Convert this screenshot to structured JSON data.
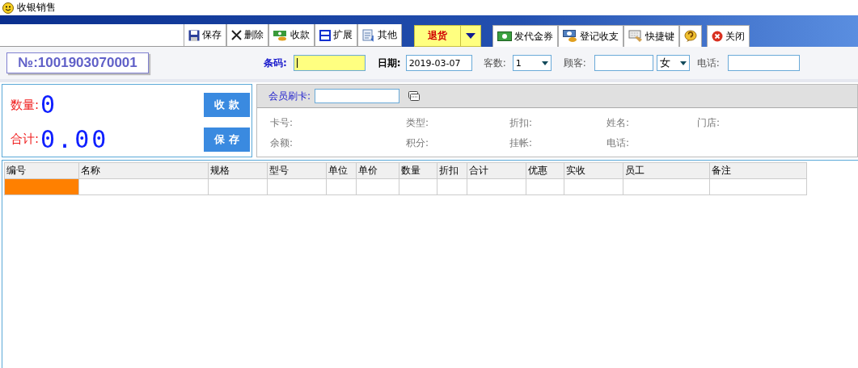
{
  "window": {
    "title": "收银销售"
  },
  "toolbar": {
    "left_buttons": [
      {
        "label": "保存",
        "kind": "save"
      },
      {
        "label": "删除",
        "kind": "delete"
      },
      {
        "label": "收款",
        "kind": "money"
      },
      {
        "label": "扩展",
        "kind": "expand"
      },
      {
        "label": "其他",
        "kind": "other"
      }
    ],
    "return_button": {
      "label": "退货"
    },
    "right_buttons": [
      {
        "label": "发代金券",
        "kind": "voucher"
      },
      {
        "label": "登记收支",
        "kind": "ledger"
      },
      {
        "label": "快捷键",
        "kind": "keyboard"
      },
      {
        "kind": "help"
      }
    ],
    "close_button": {
      "label": "关闭"
    }
  },
  "header": {
    "order_no": "№:1001903070001",
    "barcode_label": "条码:",
    "date_label": "日期:",
    "date_value": "2019-03-07",
    "guests_label": "客数:",
    "guests_value": "1",
    "customer_label": "顾客:",
    "gender_value": "女",
    "phone_label": "电话:"
  },
  "summary": {
    "qty_label": "数量:",
    "qty_value": "0",
    "total_label": "合计:",
    "total_value": "0.00",
    "buttons": [
      "收 款",
      "保 存"
    ]
  },
  "member": {
    "card_label": "会员刷卡:",
    "fields": [
      "卡号:",
      "类型:",
      "折扣:",
      "姓名:",
      "门店:",
      "余额:",
      "积分:",
      "挂帐:",
      "电话:"
    ]
  },
  "table": {
    "columns": [
      "编号",
      "名称",
      "规格",
      "型号",
      "单位",
      "单价",
      "数量",
      "折扣",
      "合计",
      "优惠",
      "实收",
      "员工",
      "备注"
    ],
    "rows": [
      {
        "selected": true
      }
    ]
  }
}
